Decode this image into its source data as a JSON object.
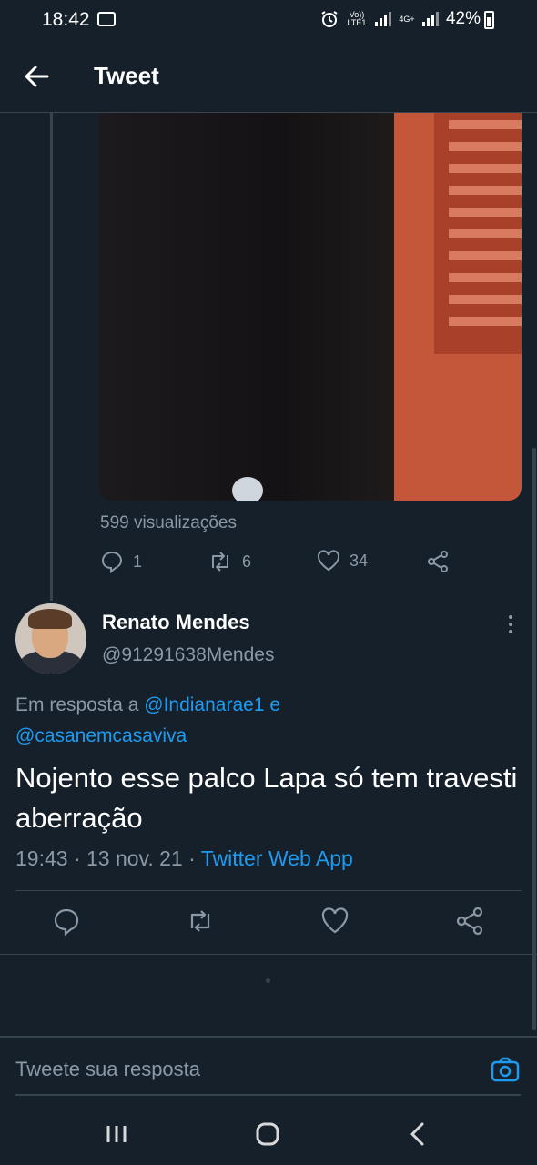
{
  "status_bar": {
    "time": "18:42",
    "volte": "Vo)) LTE1",
    "network": "4G+",
    "battery": "42%"
  },
  "header": {
    "title": "Tweet"
  },
  "parent_tweet": {
    "views": "599 visualizações",
    "stats": {
      "replies": "1",
      "retweets": "6",
      "likes": "34"
    }
  },
  "reply_tweet": {
    "author_name": "Renato Mendes",
    "author_handle": "@91291638Mendes",
    "reply_prefix": "Em resposta a",
    "reply_user_1": "@Indianarae1",
    "reply_joiner": "e",
    "reply_user_2": "@casanemcasaviva",
    "text": "Nojento esse palco Lapa só tem travesti aberração",
    "timestamp": "19:43 · 13 nov. 21 ·",
    "source": "Twitter Web App"
  },
  "composer": {
    "placeholder": "Tweete sua resposta"
  },
  "icons": {
    "back": "arrow-left-icon",
    "reply": "speech-bubble-icon",
    "retweet": "retweet-icon",
    "like": "heart-icon",
    "share": "share-icon",
    "more": "vertical-dots-icon",
    "camera": "camera-icon"
  },
  "colors": {
    "background": "#15202b",
    "accent": "#1d9bf0",
    "muted": "#8b98a5",
    "border": "#38444d"
  }
}
